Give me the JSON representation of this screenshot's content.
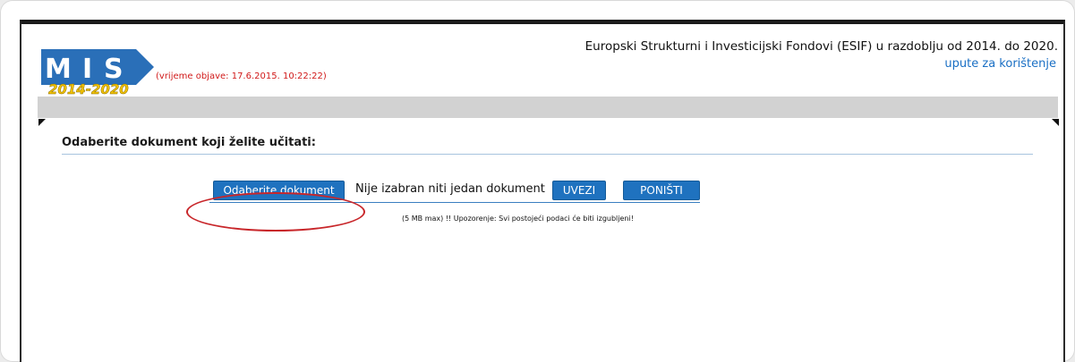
{
  "header": {
    "logo_text": "MIS 2014-2020",
    "publication_time": "(vrijeme objave: 17.6.2015. 10:22:22)",
    "site_title": "Europski Strukturni i Investicijski Fondovi (ESIF) u razdoblju od 2014. do 2020.",
    "help_link": "upute za korištenje"
  },
  "upload": {
    "section_title": "Odaberite dokument koji želite učitati:",
    "choose_button": "Odaberite dokument",
    "file_status": "Nije izabran niti jedan dokument",
    "import_button": "UVEZI",
    "cancel_button": "PONIŠTI",
    "warning": "(5 MB max) !! Upozorenje: Svi postojeći podaci će biti izgubljeni!"
  },
  "colors": {
    "brand_blue": "#1f72bf",
    "alert_red": "#d11a1a",
    "annotation_red": "#c8262a"
  },
  "icons": {
    "logo": "mis-logo"
  }
}
